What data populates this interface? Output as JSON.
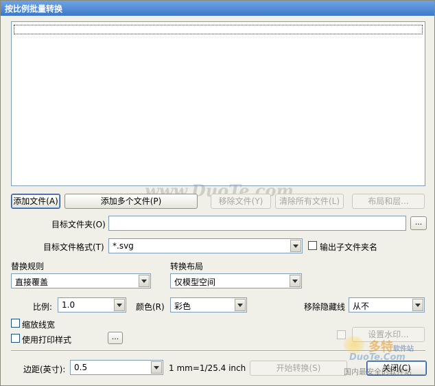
{
  "window": {
    "title": "按比例批量转换"
  },
  "file_list": {
    "items": []
  },
  "buttons": {
    "add_file": "添加文件(A)",
    "add_multiple": "添加多个文件(P)",
    "remove_file": "移除文件(Y)",
    "clear_all": "清除所有文件(L)",
    "layout_layer": "布局和层...",
    "browse": "...",
    "print_style_browse": "...",
    "set_watermark": "设置水印...",
    "start_convert": "开始转换(S)",
    "close": "关闭(C)"
  },
  "target_folder": {
    "label": "目标文件夹(O)",
    "value": ""
  },
  "target_format": {
    "label": "目标文件格式(T)",
    "value": "*.svg"
  },
  "output_subfolder": {
    "label": "输出子文件夹名",
    "checked": false
  },
  "replace_rule": {
    "label": "替换规则",
    "value": "直接覆盖"
  },
  "convert_layout": {
    "label": "转换布局",
    "value": "仅模型空间"
  },
  "scale": {
    "label": "比例:",
    "value": "1.0"
  },
  "color": {
    "label": "颜色(R)",
    "value": "彩色"
  },
  "remove_hidden": {
    "label": "移除隐藏线",
    "value": "从不"
  },
  "scale_linewidth": {
    "label": "缩放线宽",
    "checked": false
  },
  "use_print_style": {
    "label": "使用打印样式",
    "checked": false
  },
  "watermark_checkbox": {
    "checked": false
  },
  "margin": {
    "label": "边距(英寸):",
    "value": "0.5",
    "unit_note": "1 mm=1/25.4 inch"
  },
  "overlay": {
    "watermark_text": "www.DuoTe.com",
    "logo_text": "多特",
    "logo_small": "软件站",
    "logo_url": "DuoTe.Com",
    "logo_caption": "国内最安全的软件站"
  }
}
